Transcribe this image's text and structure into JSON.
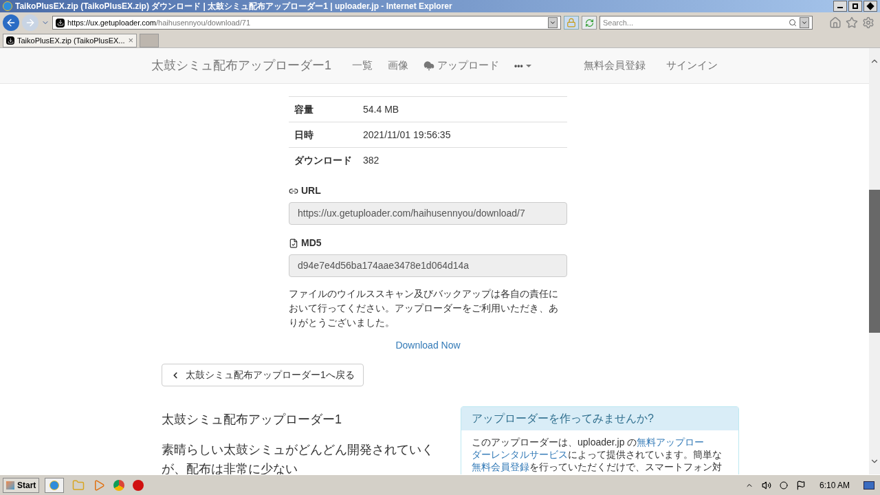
{
  "window": {
    "title": "TaikoPlusEX.zip (TaikoPlusEX.zip) ダウンロード | 太鼓シミュ配布アップローダー1 | uploader.jp - Internet Explorer"
  },
  "address_bar": {
    "url_host": "https://ux.getuploader.com",
    "url_path": "/haihusennyou/download/71"
  },
  "search": {
    "placeholder": "Search..."
  },
  "tabs": [
    {
      "label": "TaikoPlusEX.zip (TaikoPlusEX...",
      "selected": true,
      "close": "×"
    }
  ],
  "navbar": {
    "brand": "太鼓シミュ配布アップローダー1",
    "items": [
      {
        "label": "一覧",
        "kind": "text"
      },
      {
        "label": "画像",
        "kind": "text"
      },
      {
        "label": "アップロード",
        "kind": "upload"
      },
      {
        "label": "•••",
        "kind": "more"
      }
    ],
    "right_items": [
      "無料会員登録",
      "サインイン"
    ]
  },
  "file_info": [
    {
      "label": "容量",
      "value": "54.4 MB"
    },
    {
      "label": "日時",
      "value": "2021/11/01 19:56:35"
    },
    {
      "label": "ダウンロード",
      "value": "382"
    }
  ],
  "url_field": {
    "label": "URL",
    "value": "https://ux.getuploader.com/haihusennyou/download/7"
  },
  "md5_field": {
    "label": "MD5",
    "value": "d94e7e4d56ba174aae3478e1d064d14a"
  },
  "notice": "ファイルのウイルススキャン及びバックアップは各自の責任において行ってください。アップローダーをご利用いただき、ありがとうございました。",
  "download_link": "Download Now",
  "back_button": "太鼓シミュ配布アップローダー1へ戻る",
  "about": {
    "title": "太鼓シミュ配布アップローダー1",
    "description": "素晴らしい太鼓シミュがどんどん開発されていくが、配布は非常に少ない"
  },
  "promo": {
    "title": "アップローダーを作ってみませんか?",
    "body": [
      [
        {
          "text": "このアップローダーは、uploader.jp の",
          "link": false
        },
        {
          "text": "無料アップロー",
          "link": true
        }
      ],
      [
        {
          "text": "ダーレンタルサービス",
          "link": true
        },
        {
          "text": "によって提供されています。簡単な",
          "link": false
        }
      ],
      [
        {
          "text": "無料会員登録",
          "link": true
        },
        {
          "text": "を行っていただくだけで、スマートフォン対",
          "link": false
        }
      ]
    ]
  },
  "taskbar": {
    "start": "Start",
    "clock": "6:10 AM"
  }
}
